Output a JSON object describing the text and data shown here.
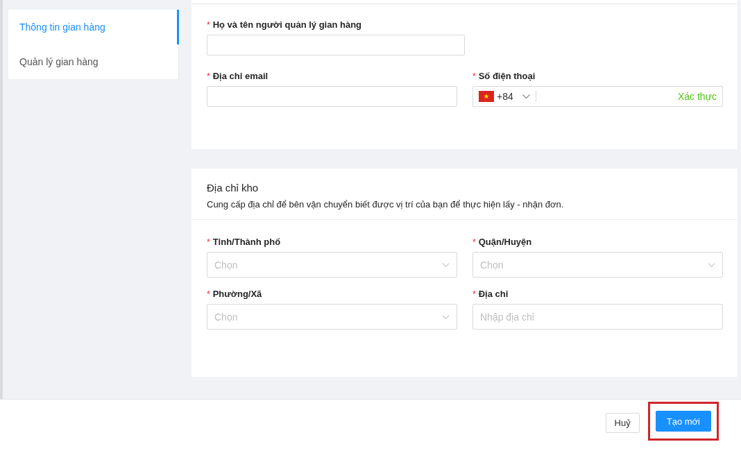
{
  "sidebar": {
    "items": [
      {
        "label": "Thông tin gian hàng",
        "selected": true
      },
      {
        "label": "Quản lý gian hàng",
        "selected": false
      }
    ]
  },
  "manager_card": {
    "fields": [
      {
        "kind": "text",
        "label": "Họ và tên người quản lý gian hàng",
        "required_mark": "*",
        "wide": true
      },
      {
        "kind": "text",
        "label": "Địa chỉ email",
        "required_mark": "*",
        "wide": false
      },
      {
        "kind": "phone",
        "label": "Số điện thoại",
        "required_mark": "*",
        "wide": false,
        "country_code": "+84",
        "action": "Xác thực"
      }
    ]
  },
  "warehouse_card": {
    "title": "Địa chỉ kho",
    "description": "Cung cấp địa chỉ để bên vận chuyển biết được vị trí của bạn để thực hiện lấy - nhận đơn.",
    "fields": [
      {
        "kind": "select",
        "label": "Tỉnh/Thành phố",
        "required_mark": "*",
        "placeholder": "Chọn"
      },
      {
        "kind": "select",
        "label": "Quận/Huyện",
        "required_mark": "*",
        "placeholder": "Chọn"
      },
      {
        "kind": "select",
        "label": "Phường/Xã",
        "required_mark": "*",
        "placeholder": "Chọn"
      },
      {
        "kind": "text",
        "label": "Địa chỉ",
        "required_mark": "*",
        "placeholder": "Nhập địa chỉ"
      }
    ]
  },
  "footer": {
    "buttons": [
      {
        "label": "Huỷ",
        "kind": "default",
        "highlighted": false
      },
      {
        "label": "Tạo mới",
        "kind": "primary",
        "highlighted": true
      }
    ]
  }
}
